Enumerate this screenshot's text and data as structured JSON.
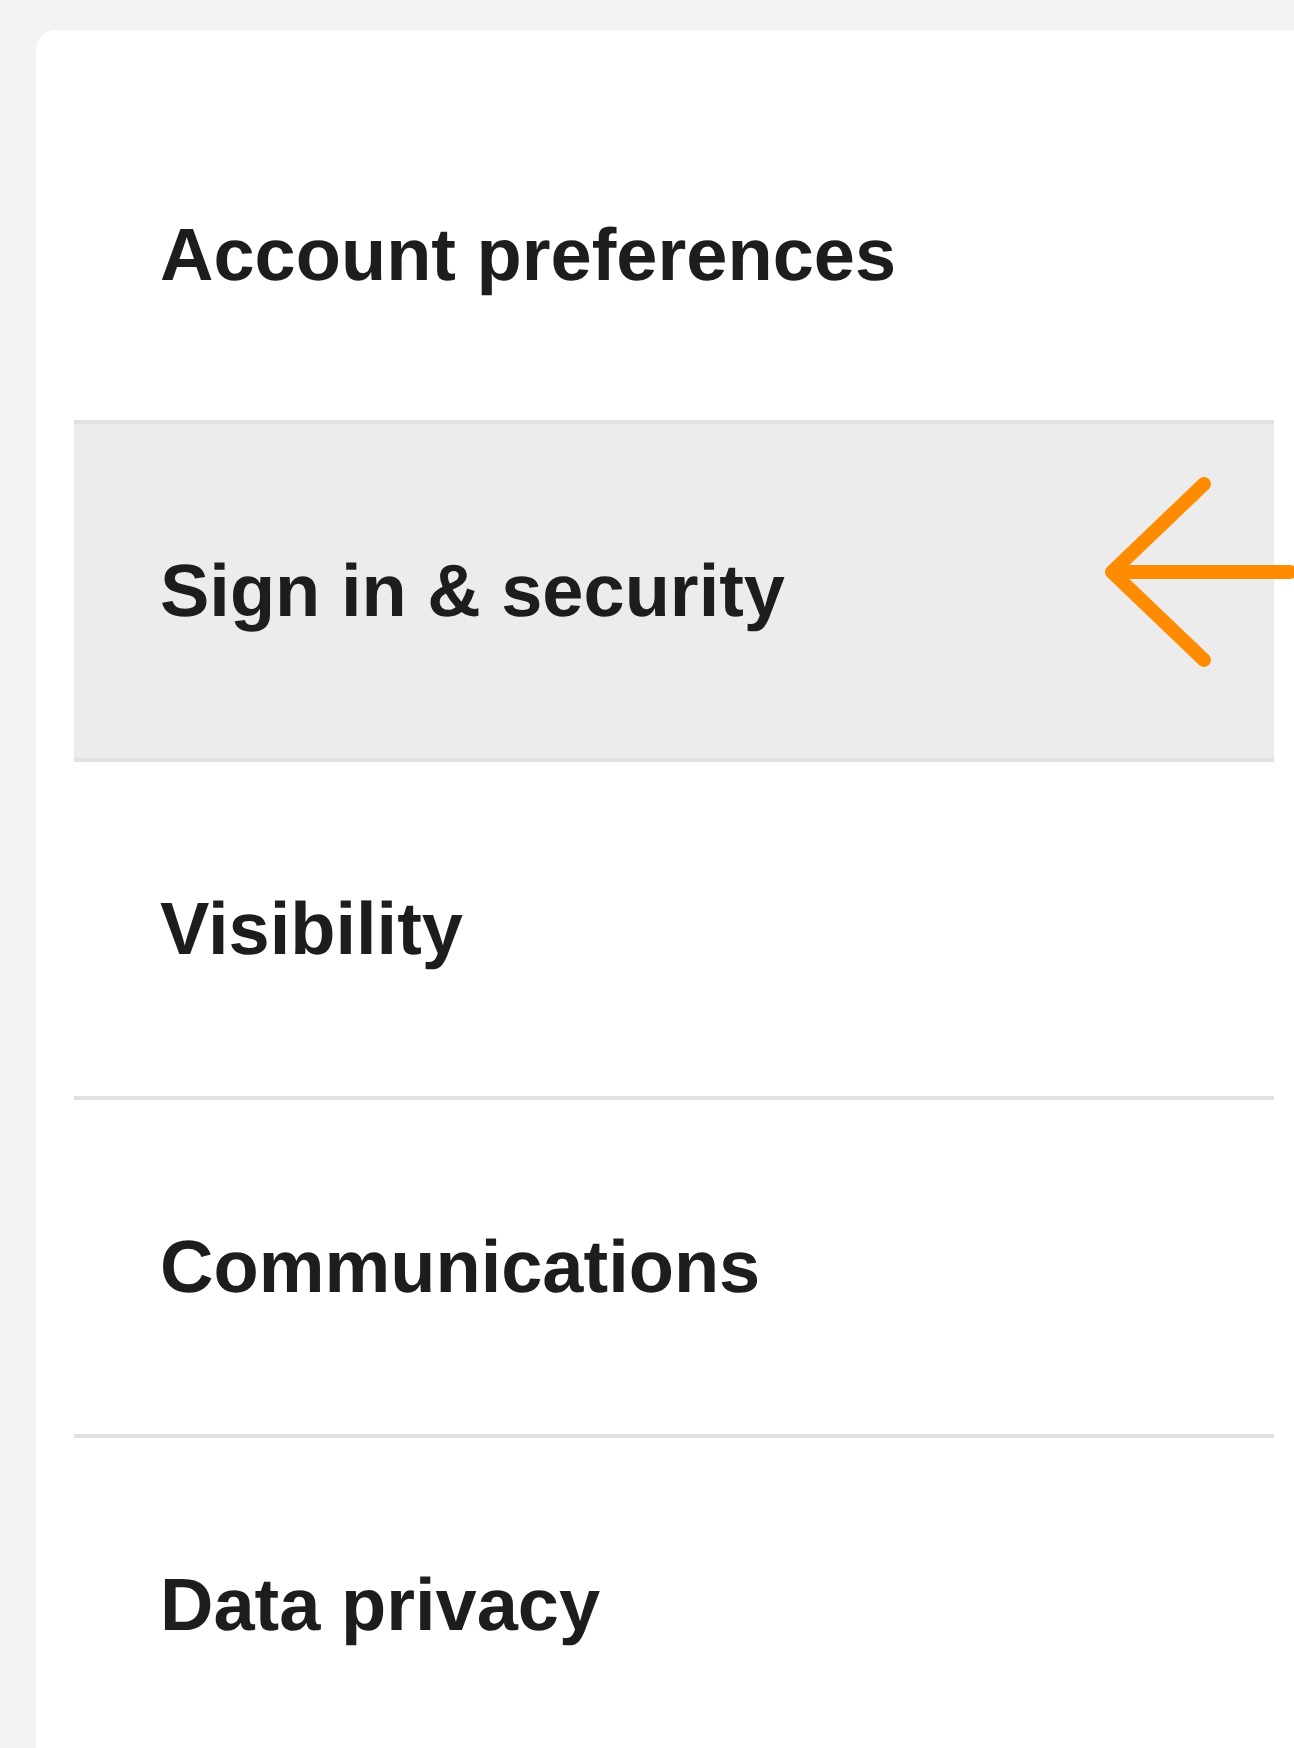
{
  "menu": {
    "items": [
      {
        "label": "Account preferences",
        "selected": false
      },
      {
        "label": "Sign in & security",
        "selected": true
      },
      {
        "label": "Visibility",
        "selected": false
      },
      {
        "label": "Communications",
        "selected": false
      },
      {
        "label": "Data privacy",
        "selected": false
      }
    ]
  }
}
